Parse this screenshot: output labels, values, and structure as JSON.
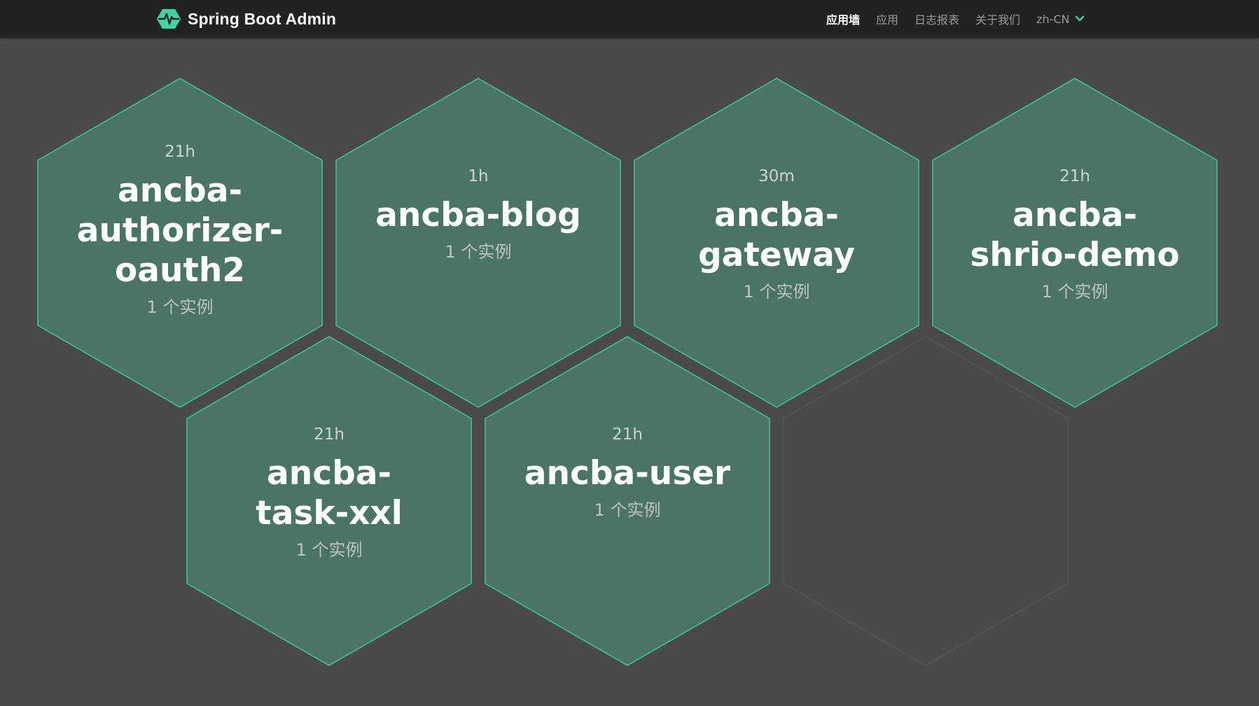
{
  "navbar": {
    "brand": "Spring Boot Admin",
    "items": [
      {
        "label": "应用墙",
        "active": true
      },
      {
        "label": "应用",
        "active": false
      },
      {
        "label": "日志报表",
        "active": false
      },
      {
        "label": "关于我们",
        "active": false
      }
    ],
    "language": "zh-CN",
    "logo_icon": "heartbeat-hexagon-icon",
    "language_icon": "chevron-down-icon"
  },
  "applications": [
    {
      "uptime": "21h",
      "name": "ancba-authorizer-oauth2",
      "instances": "1 个实例"
    },
    {
      "uptime": "1h",
      "name": "ancba-blog",
      "instances": "1 个实例"
    },
    {
      "uptime": "30m",
      "name": "ancba-gateway",
      "instances": "1 个实例"
    },
    {
      "uptime": "21h",
      "name": "ancba-shrio-demo",
      "instances": "1 个实例"
    },
    {
      "uptime": "21h",
      "name": "ancba-task-xxl",
      "instances": "1 个实例"
    },
    {
      "uptime": "21h",
      "name": "ancba-user",
      "instances": "1 个实例"
    }
  ],
  "colors": {
    "navbar_bg": "#222222",
    "page_bg": "#4a4a4a",
    "hex_fill": "#4a7566",
    "hex_stroke": "#3fc695",
    "empty_hex_stroke": "#555555",
    "brand_accent": "#42d3a5"
  }
}
